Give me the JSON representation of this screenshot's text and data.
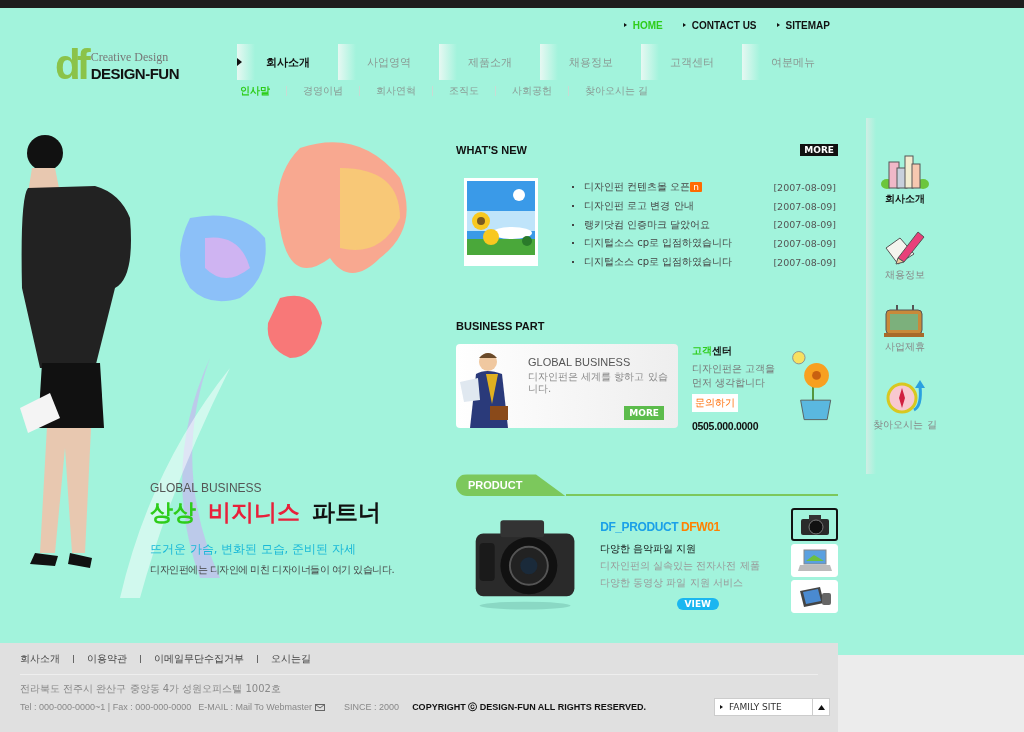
{
  "top_links": [
    {
      "label": "HOME",
      "selected": true
    },
    {
      "label": "CONTACT US",
      "selected": false
    },
    {
      "label": "SITEMAP",
      "selected": false
    }
  ],
  "logo": {
    "mark": "df",
    "tagline": "Creative Design",
    "name": "DESIGN-FUN"
  },
  "main_menu": [
    {
      "label": "회사소개",
      "selected": true
    },
    {
      "label": "사업영역",
      "selected": false
    },
    {
      "label": "제품소개",
      "selected": false
    },
    {
      "label": "채용정보",
      "selected": false
    },
    {
      "label": "고객센터",
      "selected": false
    },
    {
      "label": "여분메뉴",
      "selected": false
    }
  ],
  "sub_menu": [
    {
      "label": "인사말",
      "selected": true
    },
    {
      "label": "경영이념",
      "selected": false
    },
    {
      "label": "회사연혁",
      "selected": false
    },
    {
      "label": "조직도",
      "selected": false
    },
    {
      "label": "사회공헌",
      "selected": false
    },
    {
      "label": "찾아오시는 길",
      "selected": false
    }
  ],
  "hero": {
    "eyebrow": "GLOBAL BUSINESS",
    "headline": [
      {
        "text": "상상",
        "color": "#2ecc1a"
      },
      {
        "text": "비지니스",
        "color": "#e8203a"
      },
      {
        "text": "파트너",
        "color": "#111111"
      }
    ],
    "subheadline": "뜨거운 가슴, 변화된 모습, 준비된 자세",
    "description": "디자인펀에는 디자인에 미친 디자이너들이 여기 있습니다."
  },
  "whats_new": {
    "title": "WHAT'S NEW",
    "more": "MORE",
    "items": [
      {
        "title": "디자인펀 컨텐츠몰 오픈",
        "badge": "n",
        "date": "[2007-08-09]"
      },
      {
        "title": "디자인펀 로고 변경 안내",
        "date": "[2007-08-09]"
      },
      {
        "title": "랭키닷컴 인증마크 달았어요",
        "date": "[2007-08-09]"
      },
      {
        "title": "디지털소스 cp로 입점하였습니다",
        "date": "[2007-08-09]"
      },
      {
        "title": "디지털소스 cp로 입점하였습니다",
        "date": "[2007-08-09]"
      }
    ]
  },
  "business_part": {
    "title": "BUSINESS PART",
    "banner": {
      "title": "GLOBAL BUSINESS",
      "text": "디자인펀은 세계를 향하고 있습니다.",
      "more": "MORE"
    },
    "customer_center": {
      "title_accent": "고객",
      "title": "센터",
      "lines": [
        "디자인펀은 고객을",
        "먼저 생각합니다"
      ],
      "button": "문의하기",
      "phone": "0505.000.0000"
    }
  },
  "product": {
    "title": "PRODUCT",
    "name": "DF_PRODUCT",
    "code": "DFW01",
    "headline": "다양한 음악파일 지원",
    "lines": [
      "디자인펀의 실속있는 전자사전 제품",
      "다양한 동영상 파일 지원 서비스"
    ],
    "view": "VIEW",
    "thumbnails": [
      {
        "kind": "camera",
        "selected": true
      },
      {
        "kind": "laptop",
        "selected": false
      },
      {
        "kind": "pda",
        "selected": false
      }
    ]
  },
  "side_menu": [
    {
      "label": "회사소개",
      "kind": "buildings",
      "selected": true
    },
    {
      "label": "채용정보",
      "kind": "pencil",
      "selected": false
    },
    {
      "label": "사업제휴",
      "kind": "board",
      "selected": false
    },
    {
      "label": "찾아오시는 길",
      "kind": "compass",
      "selected": false
    }
  ],
  "footer": {
    "links": [
      "회사소개",
      "이용약관",
      "이메일무단수집거부",
      "오시는길"
    ],
    "address": "전라북도 전주시 완산구 중앙동 4가 성원오피스텔 1002호",
    "contact": "Tel : 000-000-0000~1 | Fax : 000-000-0000",
    "email": "E-MAIL : Mail To Webmaster",
    "since": "SINCE : 2000",
    "copyright": "COPYRIGHT ⓒ DESIGN-FUN  ALL RIGHTS RESERVED.",
    "family_site": "FAMILY SITE"
  }
}
